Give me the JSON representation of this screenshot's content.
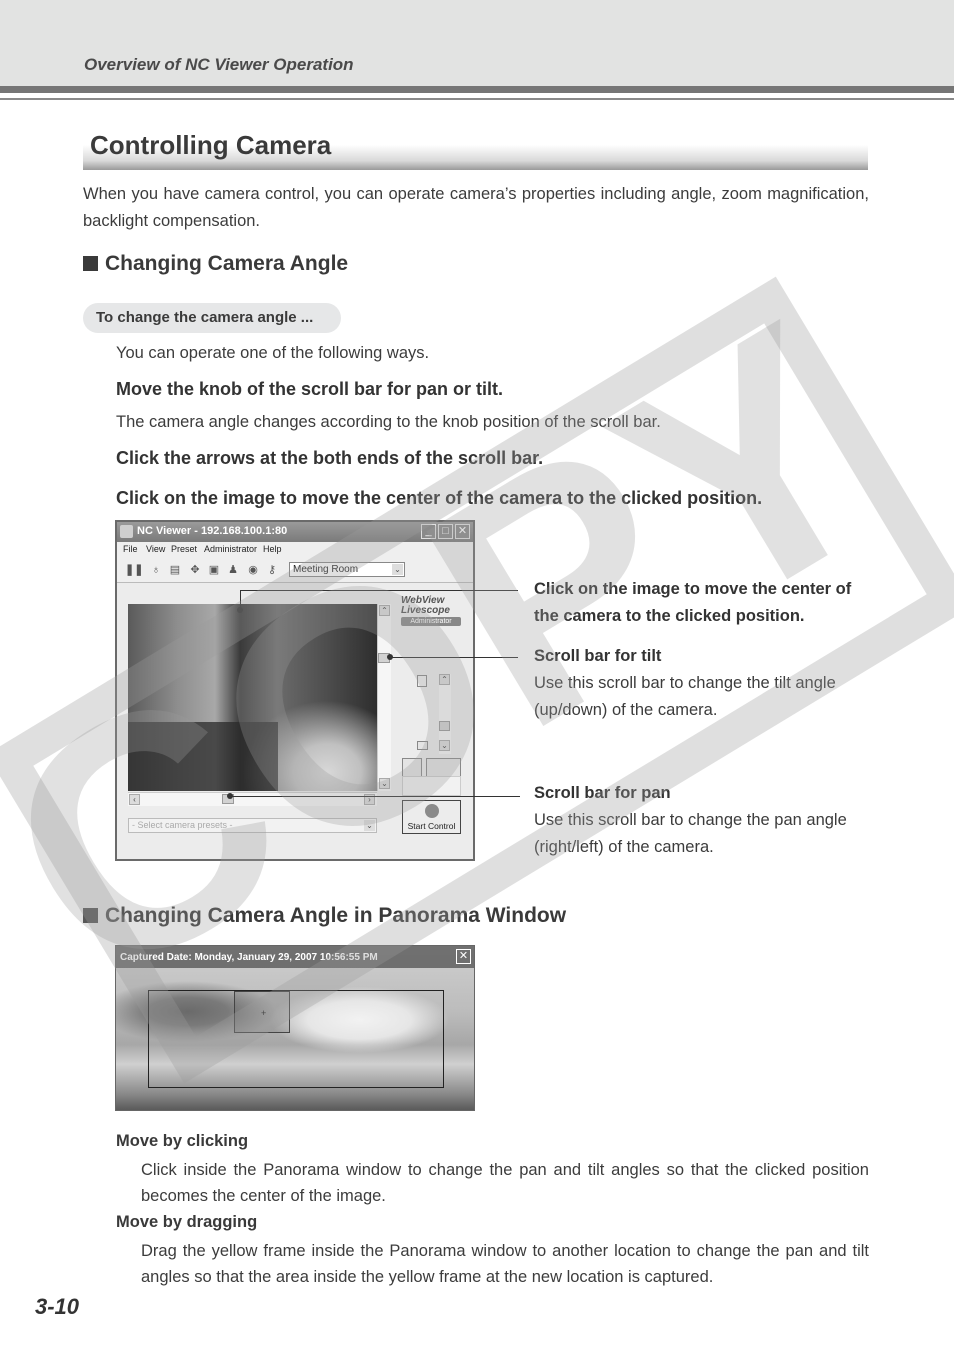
{
  "header": {
    "running_title": "Overview of NC Viewer Operation"
  },
  "section": {
    "title": "Controlling Camera",
    "intro": "When you have camera control, you can operate camera’s properties including angle, zoom magnification, backlight compensation."
  },
  "changing_angle": {
    "heading": "Changing Camera Angle",
    "pill": "To change the camera angle ...",
    "lead": "You can operate one of the following ways.",
    "way1_title": "Move the knob of the scroll bar for pan or tilt.",
    "way1_desc": "The camera angle changes according to the knob position of the scroll bar.",
    "way2_title": "Click the arrows at the both ends of the scroll bar.",
    "way3_title": "Click on the image to move the center of the camera to the clicked position."
  },
  "nc_viewer": {
    "window_title": "NC Viewer - 192.168.100.1:80",
    "menu": [
      "File",
      "View",
      "Preset",
      "Administrator",
      "Help"
    ],
    "toolbar_icons": [
      "pause-icon",
      "light-bulb-icon",
      "network-icon",
      "move-icon",
      "snapshot-icon",
      "users-icon",
      "audio-icon",
      "key-icon"
    ],
    "camera_select_value": "Meeting Room",
    "logo_line1": "WebView",
    "logo_line2": "Livescope",
    "logo_badge": "Administrator",
    "presets_placeholder": "- Select camera presets -",
    "start_control_label": "Start Control",
    "window_buttons": {
      "minimize": "_",
      "maximize": "□",
      "close": "✕"
    }
  },
  "callouts": {
    "image_click": "Click on the image to move the center of the camera to the clicked position.",
    "tilt_title": "Scroll bar for tilt",
    "tilt_desc": "Use this scroll bar to change the tilt angle (up/down) of the camera.",
    "pan_title": "Scroll bar for pan",
    "pan_desc": "Use this scroll bar to change the pan angle (right/left) of the camera."
  },
  "panorama": {
    "heading": "Changing Camera Angle in Panorama Window",
    "window_title": "Captured Date: Monday, January 29, 2007 10:56:55 PM",
    "close": "✕",
    "crosshair": "+",
    "click_title": "Move by clicking",
    "click_desc": "Click inside the Panorama window to change the pan and tilt angles so that the clicked position becomes the center of the image.",
    "drag_title": "Move by dragging",
    "drag_desc": "Drag the yellow frame inside the Panorama window to another location to change the pan and tilt angles so that the area inside the yellow frame at the new location is captured."
  },
  "watermark": {
    "text": "COPY"
  },
  "footer": {
    "page_number": "3-10"
  }
}
